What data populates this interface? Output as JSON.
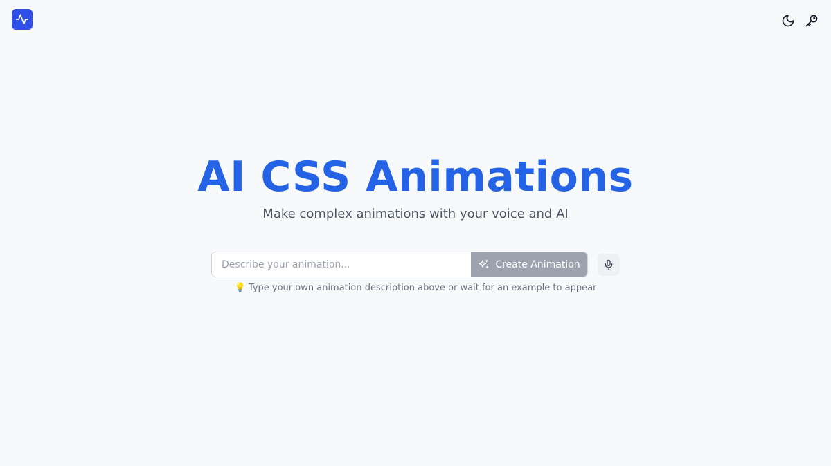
{
  "header": {
    "logo_icon": "activity-pulse-icon",
    "brand_color": "#2f50e8",
    "actions": [
      {
        "icon": "moon-icon"
      },
      {
        "icon": "key-icon"
      }
    ]
  },
  "hero": {
    "title": "AI CSS Animations",
    "subtitle": "Make complex animations with your voice and AI",
    "title_color": "#2563e6"
  },
  "form": {
    "input_value": "",
    "input_placeholder": "Describe your animation...",
    "create_label": "Create Animation",
    "create_icon": "sparkles-icon",
    "mic_icon": "microphone-icon",
    "create_button_state": "disabled"
  },
  "hint": {
    "icon": "💡",
    "text": "Type your own animation description above or wait for an example to appear"
  }
}
